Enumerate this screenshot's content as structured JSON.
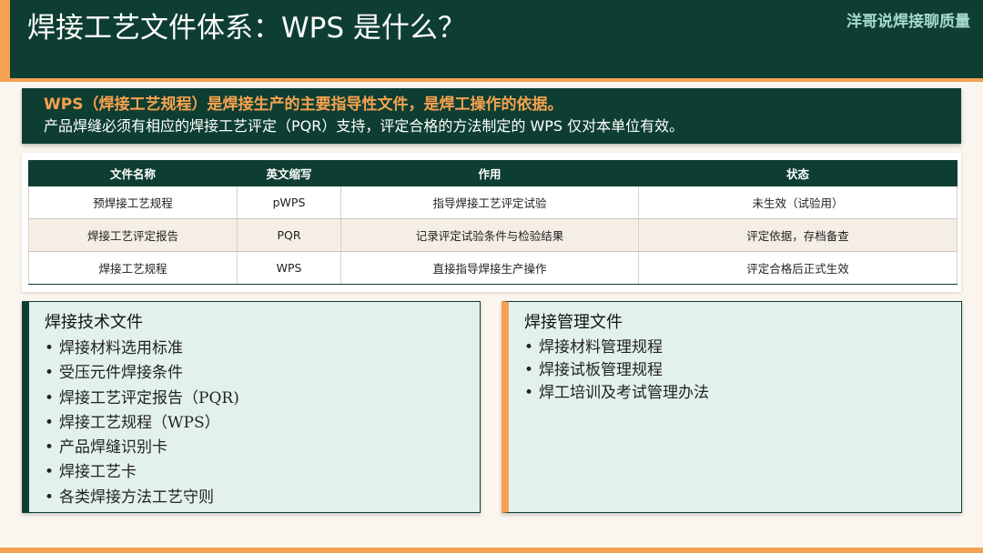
{
  "header": {
    "title": "焊接工艺文件体系：WPS 是什么？",
    "brand": "洋哥说焊接聊质量"
  },
  "intro": {
    "line1": "WPS（焊接工艺规程）是焊接生产的主要指导性文件，是焊工操作的依据。",
    "line2": "产品焊缝必须有相应的焊接工艺评定（PQR）支持，评定合格的方法制定的 WPS 仅对本单位有效。"
  },
  "table": {
    "headers": [
      "文件名称",
      "英文缩写",
      "作用",
      "状态"
    ],
    "rows": [
      [
        "预焊接工艺规程",
        "pWPS",
        "指导焊接工艺评定试验",
        "未生效（试验用）"
      ],
      [
        "焊接工艺评定报告",
        "PQR",
        "记录评定试验条件与检验结果",
        "评定依据，存档备查"
      ],
      [
        "焊接工艺规程",
        "WPS",
        "直接指导焊接生产操作",
        "评定合格后正式生效"
      ]
    ]
  },
  "cards": {
    "technical": {
      "title": "焊接技术文件",
      "items": [
        "焊接材料选用标准",
        "受压元件焊接条件",
        "焊接工艺评定报告（PQR)",
        "焊接工艺规程（WPS）",
        "产品焊缝识别卡",
        "焊接工艺卡",
        "各类焊接方法工艺守则"
      ]
    },
    "management": {
      "title": "焊接管理文件",
      "items": [
        "焊接材料管理规程",
        "焊接试板管理规程",
        "焊工培训及考试管理办法"
      ]
    }
  },
  "colors": {
    "primary": "#0e3e32",
    "accent": "#f5a153",
    "highlight_text": "#f6a24f",
    "brand_text": "#a5d8cf",
    "card_bg": "#e3f1ee",
    "page_bg": "#faf5ee"
  }
}
